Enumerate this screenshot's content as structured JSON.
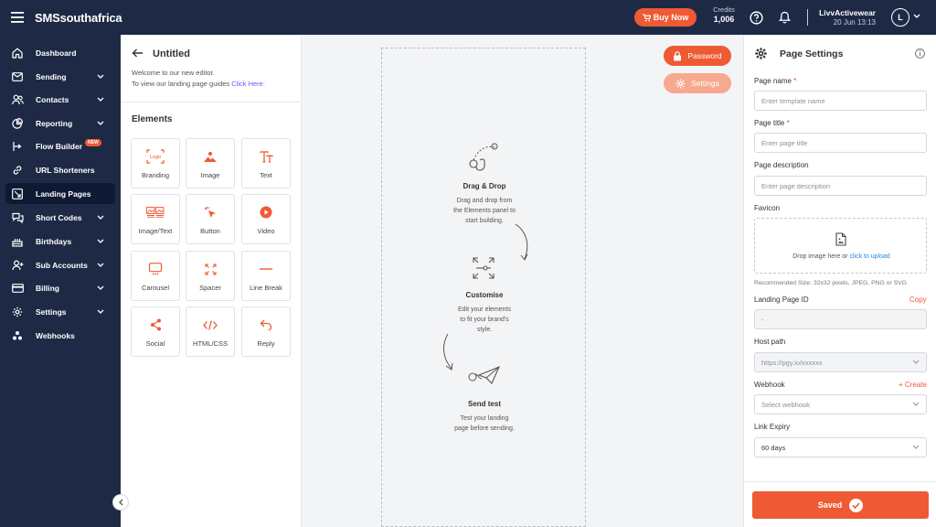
{
  "topbar": {
    "brand": "SMSsouthafrica",
    "buy_now": "Buy Now",
    "credits_label": "Credits",
    "credits_value": "1,006",
    "account_name": "LivvActivewear",
    "account_date": "20 Jun 13:13",
    "avatar_initial": "L"
  },
  "sidebar": {
    "items": [
      {
        "label": "Dashboard",
        "icon": "home-icon"
      },
      {
        "label": "Sending",
        "icon": "envelope-icon"
      },
      {
        "label": "Contacts",
        "icon": "users-icon"
      },
      {
        "label": "Reporting",
        "icon": "pie-chart-icon"
      },
      {
        "label": "Flow Builder",
        "icon": "flow-icon",
        "badge": "NEW"
      },
      {
        "label": "URL Shorteners",
        "icon": "link-icon"
      },
      {
        "label": "Landing Pages",
        "icon": "landing-page-icon"
      },
      {
        "label": "Short Codes",
        "icon": "chat-icon"
      },
      {
        "label": "Birthdays",
        "icon": "cake-icon"
      },
      {
        "label": "Sub Accounts",
        "icon": "user-plus-icon"
      },
      {
        "label": "Billing",
        "icon": "credit-card-icon"
      },
      {
        "label": "Settings",
        "icon": "gear-icon"
      },
      {
        "label": "Webhooks",
        "icon": "webhook-icon"
      }
    ]
  },
  "elements_panel": {
    "title": "Untitled",
    "intro_line1": "Welcome to our new editor.",
    "intro_line2": "To view our landing page guides ",
    "intro_link": "Click Here.",
    "section_title": "Elements",
    "tiles": [
      "Branding",
      "Image",
      "Text",
      "Image/Text",
      "Button",
      "Video",
      "Carousel",
      "Spacer",
      "Line Break",
      "Social",
      "HTML/CSS",
      "Reply"
    ],
    "logo_text": "Logo"
  },
  "canvas": {
    "password_button": "Password",
    "settings_button": "Settings",
    "steps": [
      {
        "title": "Drag & Drop",
        "desc_lines": [
          "Drag and drop from",
          "the Elements panel to",
          "start building."
        ]
      },
      {
        "title": "Customise",
        "desc_lines": [
          "Edit your elements",
          "to fit your brand's",
          "style."
        ]
      },
      {
        "title": "Send test",
        "desc_lines": [
          "Test your landing",
          "page before sending."
        ]
      }
    ]
  },
  "settings_panel": {
    "title": "Page Settings",
    "page_name_label": "Page name",
    "page_name_placeholder": "Enter template name",
    "page_title_label": "Page title",
    "page_title_placeholder": "Enter page title",
    "page_desc_label": "Page description",
    "page_desc_placeholder": "Enter page description",
    "favicon_label": "Favicon",
    "drop_text": "Drop image here or ",
    "drop_link": "click to upload",
    "recommended": "Recommended Size: 32x32 pixels, JPEG, PNG or SVG",
    "landing_id_label": "Landing Page ID",
    "copy_link": "Copy",
    "landing_id_value": "-",
    "host_path_label": "Host path",
    "host_path_value": "https://pgy.io/xxxxxx",
    "webhook_label": "Webhook",
    "create_link": "+ Create",
    "webhook_placeholder": "Select webhook",
    "link_expiry_label": "Link Expiry",
    "link_expiry_value": "60 days",
    "required_marker": "*",
    "save_button": "Saved"
  },
  "colors": {
    "navy": "#1e2a45",
    "accent": "#ee5a34",
    "link_purple": "#7c4dff",
    "link_blue": "#1e88e5"
  }
}
